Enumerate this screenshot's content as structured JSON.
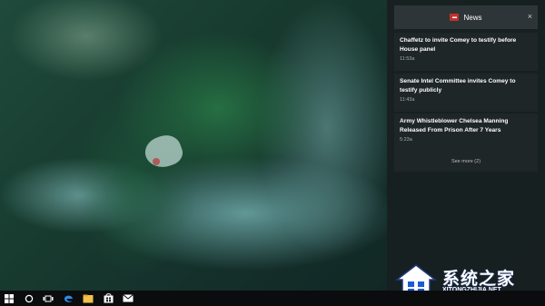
{
  "action_center": {
    "app_title": "News",
    "close_glyph": "×",
    "icon": "news-icon",
    "accent_color": "#c3312a",
    "notifications": [
      {
        "headline": "Chaffetz to invite Comey to testify before House panel",
        "time": "11:53a"
      },
      {
        "headline": "Senate Intel Committee invites Comey to testify publicly",
        "time": "11:43a"
      },
      {
        "headline": "Army Whistleblower Chelsea Manning Released From Prison After 7 Years",
        "time": "5:23a"
      }
    ],
    "see_more": "See more (2)"
  },
  "taskbar": {
    "icons": [
      "windows-start-icon",
      "cortana-search-icon",
      "task-view-icon",
      "edge-browser-icon",
      "file-explorer-icon",
      "store-icon",
      "mail-icon"
    ]
  },
  "watermark": {
    "text": "系统之家",
    "url": "XITONGZHIJIA.NET"
  }
}
